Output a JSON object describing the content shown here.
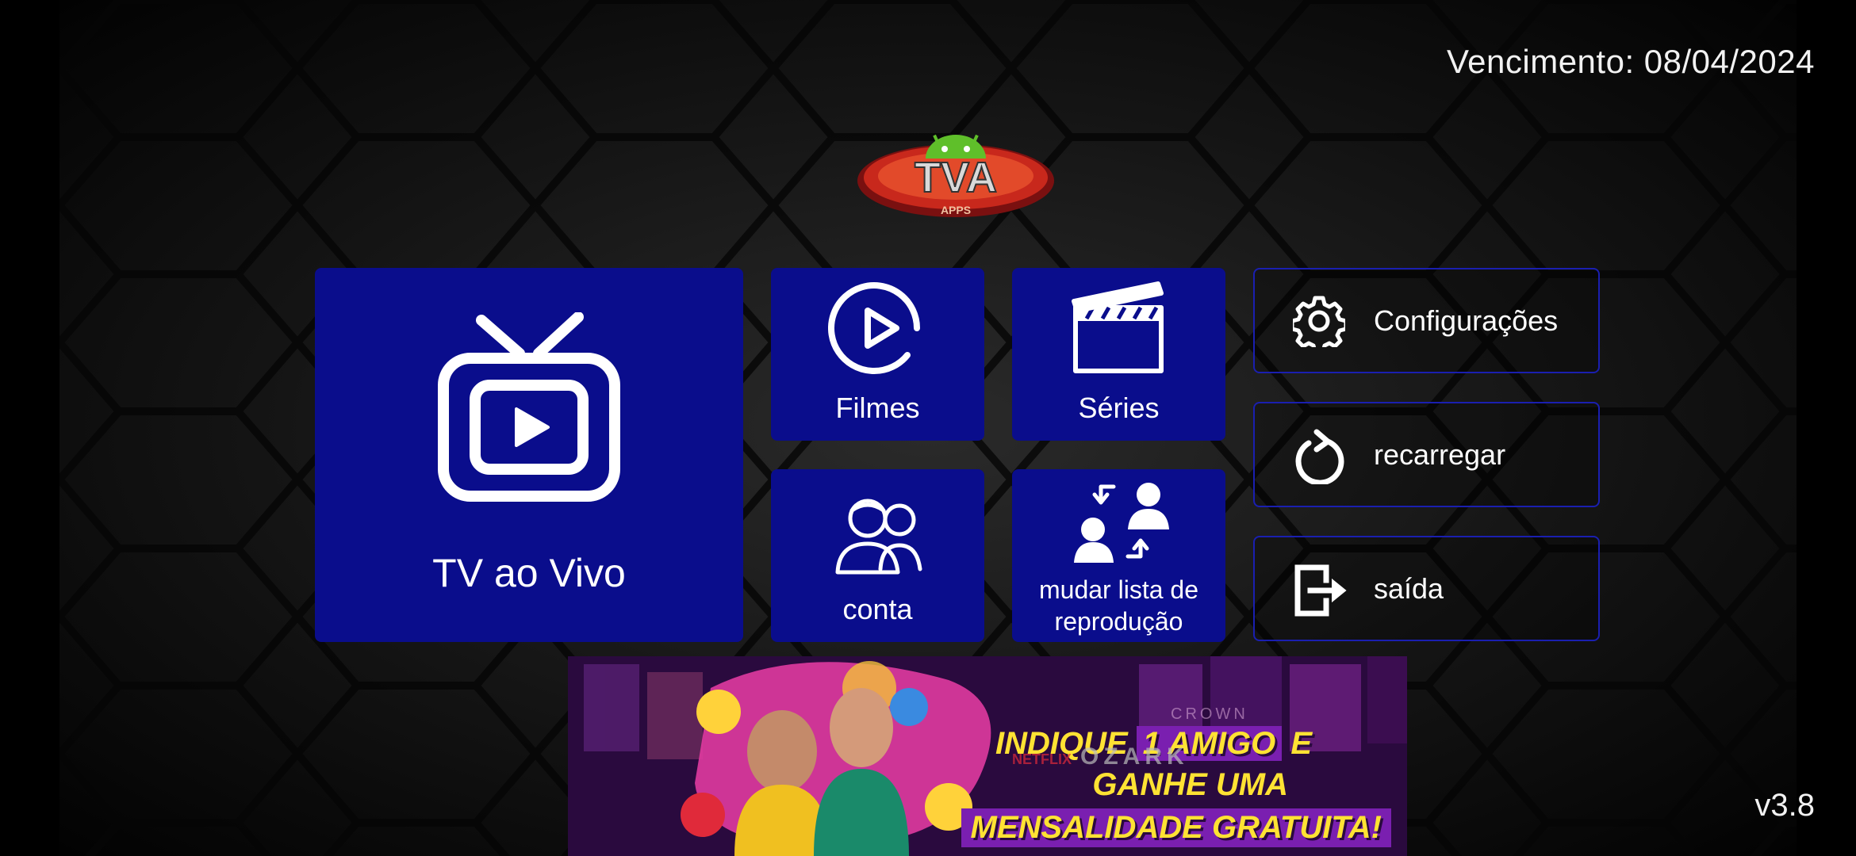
{
  "header": {
    "expiry": "Vencimento: 08/04/2024"
  },
  "footer": {
    "version": "v3.8"
  },
  "logo": {
    "text": "TVA",
    "subtext": "APPS"
  },
  "tiles": {
    "live_tv": "TV ao Vivo",
    "movies": "Filmes",
    "series": "Séries",
    "account": "conta",
    "change_playlist_line1": "mudar lista de",
    "change_playlist_line2": "reprodução"
  },
  "side_buttons": {
    "settings": "Configurações",
    "reload": "recarregar",
    "exit": "saída"
  },
  "banner": {
    "line1_a": "INDIQUE",
    "line1_b": "1 AMIGO",
    "line1_c": "E",
    "line2": "GANHE UMA",
    "line3": "MENSALIDADE GRATUITA!",
    "bg_words": [
      "NETFLIX",
      "OZARK",
      "CROWN"
    ]
  },
  "colors": {
    "tile_blue": "#0a0d8c",
    "border_blue": "#1a1fb0",
    "banner_yellow": "#ffe233"
  }
}
